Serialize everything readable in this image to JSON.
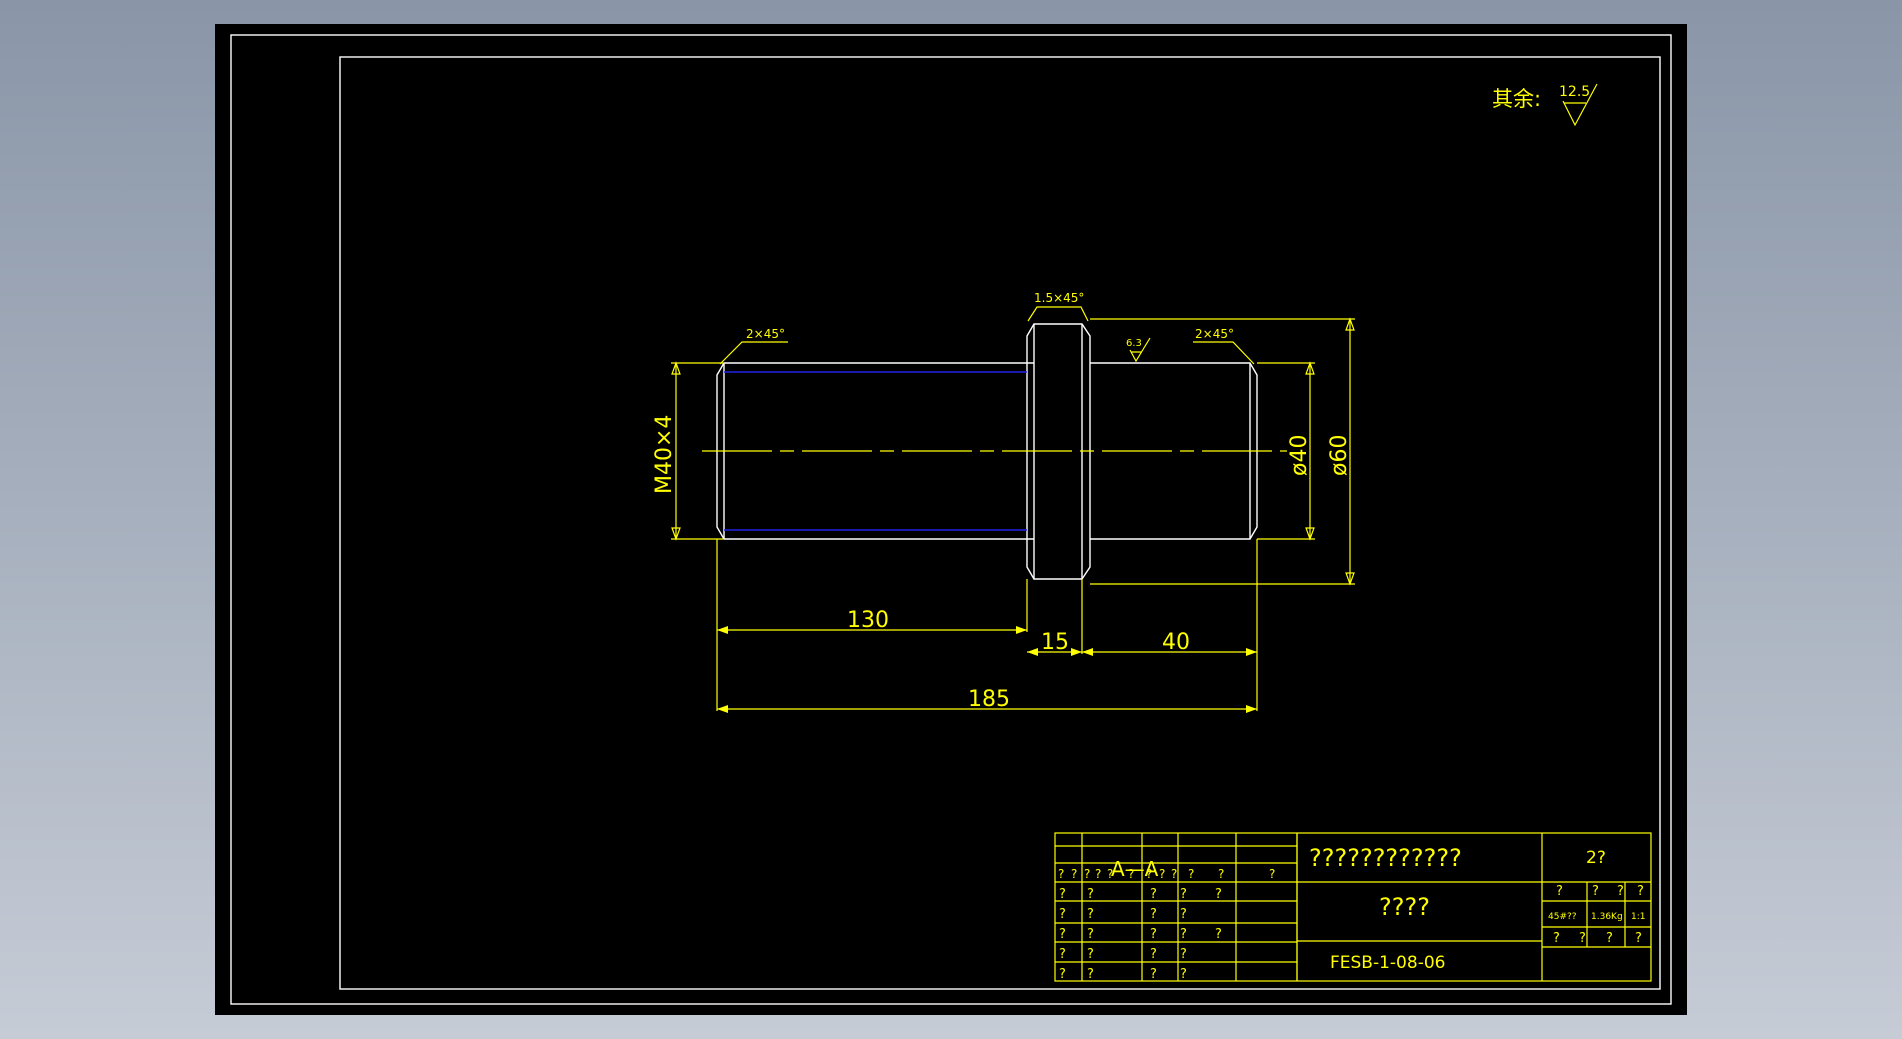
{
  "roughness_note": {
    "label": "其余:",
    "value": "12.5"
  },
  "surface_mark": "6.3",
  "chamfers": {
    "left": "2×45°",
    "collar": "1.5×45°",
    "right": "2×45°"
  },
  "dimensions": {
    "thread": "M40×4",
    "dia_small": "ø40",
    "dia_large": "ø60",
    "len_130": "130",
    "len_15": "15",
    "len_40": "40",
    "len_185": "185"
  },
  "title_block": {
    "section_label": "A—A",
    "drawing_title": "????????????",
    "part_name": "????",
    "drawing_number": "FESB-1-08-06",
    "sheet": "2?",
    "material": "45#??",
    "weight": "1.36Kg",
    "scale": "1:1",
    "header_marks": [
      "?",
      "?",
      "?",
      "?"
    ],
    "footer_marks": [
      "?",
      "?",
      "?",
      "?"
    ],
    "left_row_marks": [
      "?",
      "?",
      "?",
      "?",
      "?",
      "?",
      "?",
      "?",
      "?",
      "?",
      "?",
      "?"
    ],
    "left_grid_marks": [
      "?",
      "?",
      "?",
      "?",
      "?",
      "?",
      "?",
      "?",
      "?",
      "?",
      "?",
      "?",
      "?",
      "?",
      "?",
      "?",
      "?",
      "?",
      "?",
      "?",
      "?",
      "?"
    ]
  },
  "colors": {
    "background": "#000000",
    "outline": "#ffffff",
    "annotation": "#ffff00",
    "thread_line": "#2323e6"
  }
}
